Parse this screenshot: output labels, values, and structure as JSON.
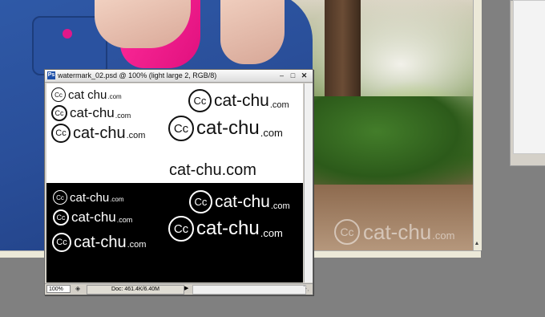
{
  "window": {
    "title": "watermark_02.psd @ 100% (light large 2, RGB/8)",
    "app_icon": "Ps",
    "controls": {
      "minimize": "‒",
      "maximize": "□",
      "close": "✕"
    }
  },
  "watermarks_dark": [
    {
      "mark": "Cc",
      "main": "cat chu",
      "suffix": ".com"
    },
    {
      "mark": "Cc",
      "main": "cat-chu",
      "suffix": ".com"
    },
    {
      "mark": "Cc",
      "main": "cat-chu",
      "suffix": ".com"
    },
    {
      "mark": "Cc",
      "main": "cat-chu",
      "suffix": ".com"
    },
    {
      "mark": "Cc",
      "main": "cat-chu",
      "suffix": ".com"
    }
  ],
  "plain_text": "cat-chu.com",
  "watermarks_light": [
    {
      "mark": "Cc",
      "main": "cat-chu",
      "suffix": ".com"
    },
    {
      "mark": "Cc",
      "main": "cat-chu",
      "suffix": ".com"
    },
    {
      "mark": "Cc",
      "main": "cat-chu",
      "suffix": ".com"
    },
    {
      "mark": "Cc",
      "main": "cat-chu",
      "suffix": ".com"
    },
    {
      "mark": "Cc",
      "main": "cat-chu",
      "suffix": ".com"
    }
  ],
  "statusbar": {
    "zoom": "100%",
    "doc_info": "Doc: 461.4K/6.40M",
    "arrow": "▶"
  },
  "background_photo": {
    "watermark": {
      "mark": "Cc",
      "main": "cat-chu",
      "suffix": ".com"
    },
    "scroll_up": "▲"
  },
  "colors": {
    "jacket": "#2a4f9a",
    "accent_pink": "#e0107e",
    "canvas_black": "#000000",
    "canvas_white": "#ffffff"
  }
}
